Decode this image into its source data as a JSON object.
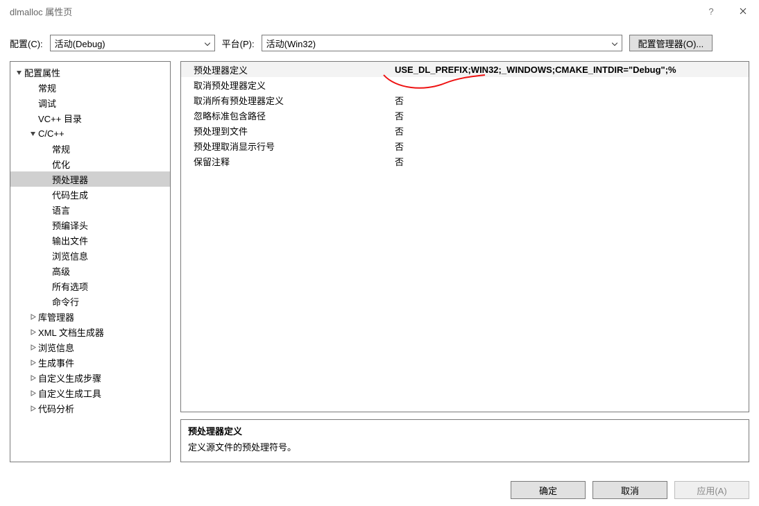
{
  "titlebar": {
    "title": "dlmalloc 属性页",
    "help": "?",
    "close_glyph": "x"
  },
  "toolbar": {
    "config_label": "配置(C):",
    "config_value": "活动(Debug)",
    "platform_label": "平台(P):",
    "platform_value": "活动(Win32)",
    "manager_button": "配置管理器(O)..."
  },
  "tree": [
    {
      "level": 0,
      "label": "配置属性",
      "expander": "down",
      "selected": false
    },
    {
      "level": 1,
      "label": "常规",
      "expander": "none",
      "selected": false
    },
    {
      "level": 1,
      "label": "调试",
      "expander": "none",
      "selected": false
    },
    {
      "level": 1,
      "label": "VC++ 目录",
      "expander": "none",
      "selected": false
    },
    {
      "level": 1,
      "label": "C/C++",
      "expander": "down",
      "selected": false
    },
    {
      "level": 2,
      "label": "常规",
      "expander": "none",
      "selected": false
    },
    {
      "level": 2,
      "label": "优化",
      "expander": "none",
      "selected": false
    },
    {
      "level": 2,
      "label": "预处理器",
      "expander": "none",
      "selected": true
    },
    {
      "level": 2,
      "label": "代码生成",
      "expander": "none",
      "selected": false
    },
    {
      "level": 2,
      "label": "语言",
      "expander": "none",
      "selected": false
    },
    {
      "level": 2,
      "label": "预编译头",
      "expander": "none",
      "selected": false
    },
    {
      "level": 2,
      "label": "输出文件",
      "expander": "none",
      "selected": false
    },
    {
      "level": 2,
      "label": "浏览信息",
      "expander": "none",
      "selected": false
    },
    {
      "level": 2,
      "label": "高级",
      "expander": "none",
      "selected": false
    },
    {
      "level": 2,
      "label": "所有选项",
      "expander": "none",
      "selected": false
    },
    {
      "level": 2,
      "label": "命令行",
      "expander": "none",
      "selected": false
    },
    {
      "level": 1,
      "label": "库管理器",
      "expander": "right",
      "selected": false
    },
    {
      "level": 1,
      "label": "XML 文档生成器",
      "expander": "right",
      "selected": false
    },
    {
      "level": 1,
      "label": "浏览信息",
      "expander": "right",
      "selected": false
    },
    {
      "level": 1,
      "label": "生成事件",
      "expander": "right",
      "selected": false
    },
    {
      "level": 1,
      "label": "自定义生成步骤",
      "expander": "right",
      "selected": false
    },
    {
      "level": 1,
      "label": "自定义生成工具",
      "expander": "right",
      "selected": false
    },
    {
      "level": 1,
      "label": "代码分析",
      "expander": "right",
      "selected": false
    }
  ],
  "grid": [
    {
      "label": "预处理器定义",
      "value": "USE_DL_PREFIX;WIN32;_WINDOWS;CMAKE_INTDIR=\"Debug\";%",
      "active": true
    },
    {
      "label": "取消预处理器定义",
      "value": "",
      "active": false
    },
    {
      "label": "取消所有预处理器定义",
      "value": "否",
      "active": false
    },
    {
      "label": "忽略标准包含路径",
      "value": "否",
      "active": false
    },
    {
      "label": "预处理到文件",
      "value": "否",
      "active": false
    },
    {
      "label": "预处理取消显示行号",
      "value": "否",
      "active": false
    },
    {
      "label": "保留注释",
      "value": "否",
      "active": false
    }
  ],
  "description": {
    "title": "预处理器定义",
    "body": "定义源文件的预处理符号。"
  },
  "buttons": {
    "ok": "确定",
    "cancel": "取消",
    "apply": "应用(A)"
  }
}
